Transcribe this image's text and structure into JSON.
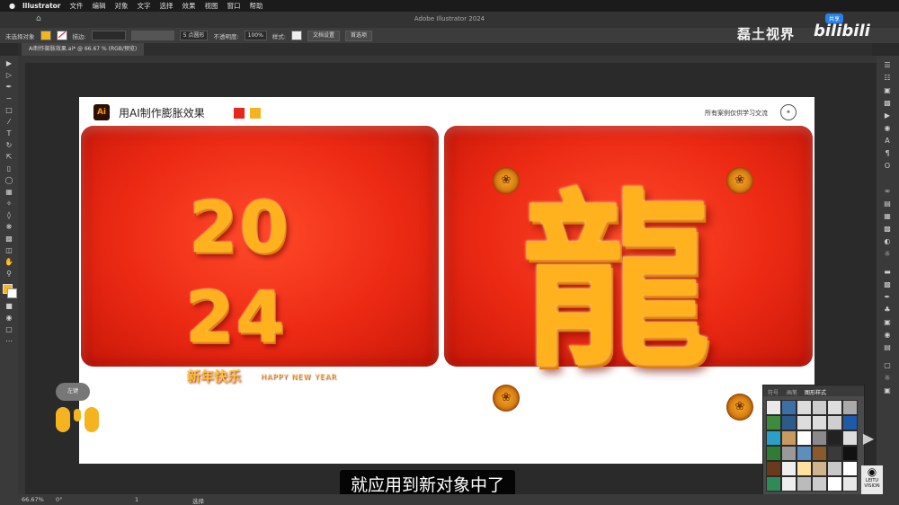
{
  "menubar": {
    "apple": "",
    "app": "Illustrator",
    "items": [
      "文件",
      "编辑",
      "对象",
      "文字",
      "选择",
      "效果",
      "视图",
      "窗口",
      "帮助"
    ]
  },
  "window": {
    "title": "Adobe Illustrator 2024",
    "share": "共享"
  },
  "control_bar": {
    "no_selection": "未选择对象",
    "stroke_label": "描边:",
    "brush_value": "5 点圆形",
    "opacity_label": "不透明度:",
    "opacity_value": "100%",
    "style_label": "样式:",
    "doc_setup": "文档设置",
    "preferences": "首选项"
  },
  "watermark": {
    "channel": "磊土视界",
    "site": "bilibili"
  },
  "document_tab": {
    "label": "AI制作膨胀效果.ai* @ 66.67 % (RGB/预览)"
  },
  "artboard": {
    "logo_text": "Ai",
    "title": "用AI制作膨胀效果",
    "note": "所有案例仅供学习交流",
    "colors": {
      "red": "#e8261a",
      "yellow": "#f5b41f"
    },
    "left_panel": {
      "line1": "20",
      "line2": "24",
      "greeting": "新年快乐",
      "english": "HAPPY NEW YEAR"
    },
    "right_panel": {
      "character": "龍"
    }
  },
  "mouse_overlay": {
    "label": "左键"
  },
  "subtitle": "就应用到新对象中了",
  "status_bar": {
    "zoom": "66.67%",
    "angle": "0°",
    "page": "1",
    "tool": "选择"
  },
  "graphic_styles_panel": {
    "tabs": [
      "符号",
      "画笔",
      "图形样式"
    ]
  },
  "corner_logo": {
    "line1": "LEITU",
    "line2": "VISION"
  }
}
